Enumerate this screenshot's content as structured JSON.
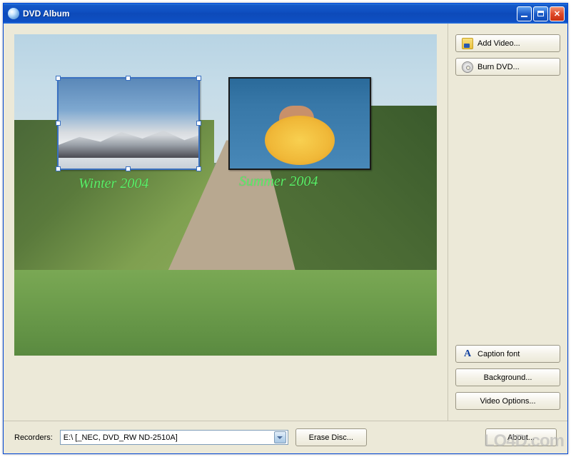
{
  "window": {
    "title": "DVD Album"
  },
  "preview": {
    "thumbnails": [
      {
        "caption": "Winter 2004",
        "selected": true
      },
      {
        "caption": "Summer 2004",
        "selected": false
      }
    ]
  },
  "sidebar": {
    "add_video_label": "Add Video...",
    "burn_dvd_label": "Burn DVD...",
    "caption_font_label": "Caption font",
    "background_label": "Background...",
    "video_options_label": "Video Options..."
  },
  "bottom": {
    "recorders_label": "Recorders:",
    "recorder_selected": "E:\\ [_NEC, DVD_RW ND-2510A]",
    "erase_disc_label": "Erase Disc...",
    "about_label": "About..."
  },
  "watermark": "LO4D.com"
}
